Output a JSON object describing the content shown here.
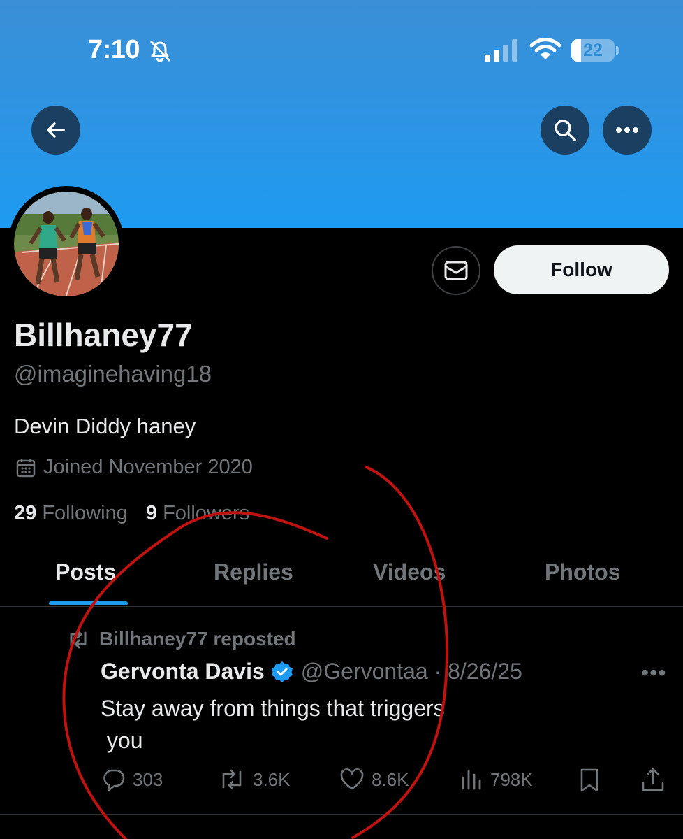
{
  "status_bar": {
    "time": "7:10",
    "battery": "22",
    "battery_level": 0.22
  },
  "header": {
    "back_icon": "arrow-left-icon",
    "search_icon": "search-icon",
    "more_icon": "more-horizontal-icon"
  },
  "profile": {
    "display_name": "Billhaney77",
    "handle": "@imaginehaving18",
    "bio": "Devin Diddy haney",
    "joined": "Joined November 2020",
    "following_count": "29",
    "following_label": "Following",
    "followers_count": "9",
    "followers_label": "Followers",
    "follow_label": "Follow"
  },
  "tabs": [
    {
      "label": "Posts",
      "active": true
    },
    {
      "label": "Replies",
      "active": false
    },
    {
      "label": "Videos",
      "active": false
    },
    {
      "label": "Photos",
      "active": false
    }
  ],
  "post": {
    "repost_label": "Billhaney77 reposted",
    "author_name": "Gervonta Davis",
    "author_meta": "@Gervontaa · 8/26/25",
    "text": "Stay away from things that triggers\n you",
    "replies": "303",
    "reposts": "3.6K",
    "likes": "8.6K",
    "views": "798K"
  },
  "colors": {
    "accent": "#1d9bf0",
    "annotation": "#c0120f",
    "banner": "#1d9bf0"
  }
}
